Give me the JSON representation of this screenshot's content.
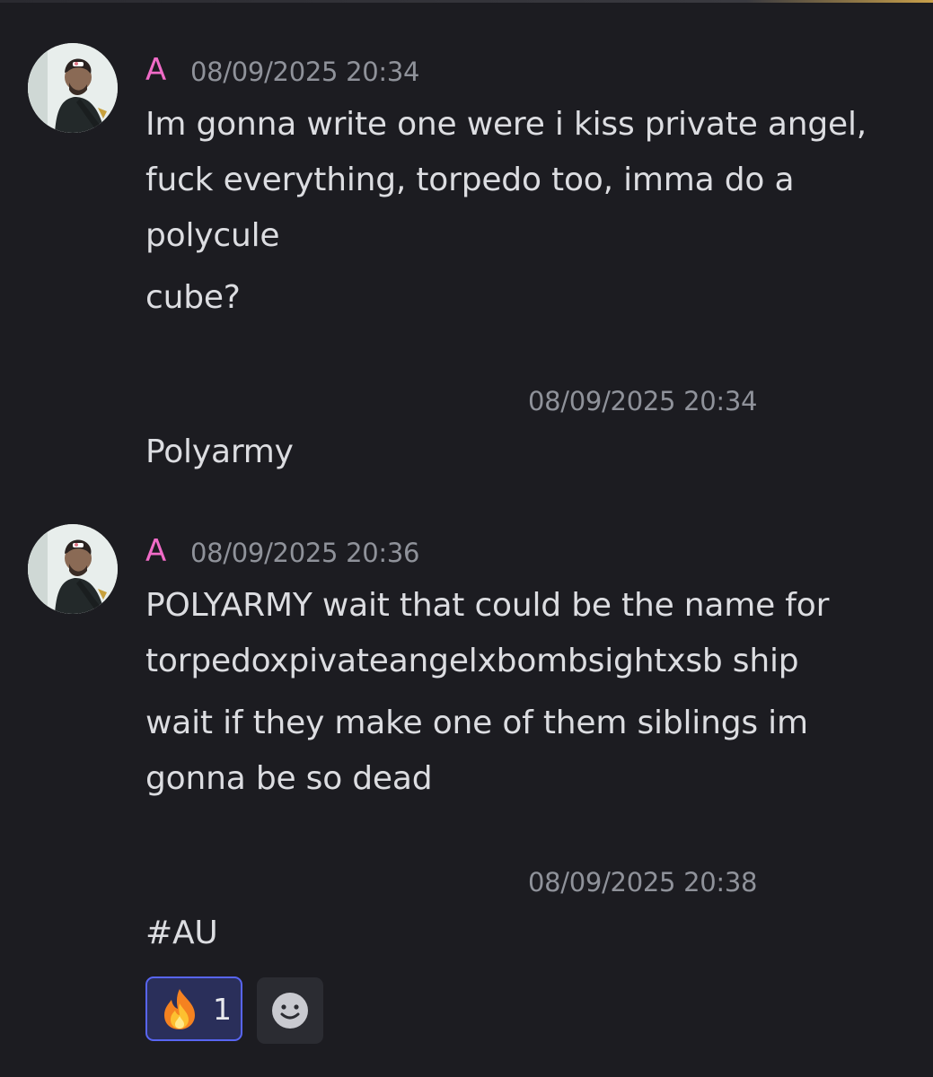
{
  "messages": [
    {
      "author": "A",
      "timestamp": "08/09/2025 20:34",
      "lines": [
        "Im gonna write one were i kiss private angel,",
        "fuck everything, torpedo too, imma do a",
        "polycule"
      ],
      "followup": "cube?"
    },
    {
      "timestamp": "08/09/2025 20:34",
      "text": "Polyarmy"
    },
    {
      "author": "A",
      "timestamp": "08/09/2025 20:36",
      "lines": [
        "POLYARMY wait that could be the name for",
        "torpedoxpivateangelxbombsightxsb ship"
      ],
      "followup_lines": [
        "wait if they make one of them siblings im",
        "gonna be so dead"
      ]
    },
    {
      "timestamp": "08/09/2025 20:38",
      "text": "#AU"
    }
  ],
  "reaction": {
    "emoji": "fire-icon",
    "count": "1"
  },
  "add_reaction_icon": "smiley-add-reaction-icon",
  "colors": {
    "background": "#1c1c21",
    "author": "#f06bc7",
    "timestamp": "#8f929a",
    "text": "#dcdde1",
    "reaction_border": "#5865f2",
    "reaction_bg": "#2a2f5a"
  }
}
